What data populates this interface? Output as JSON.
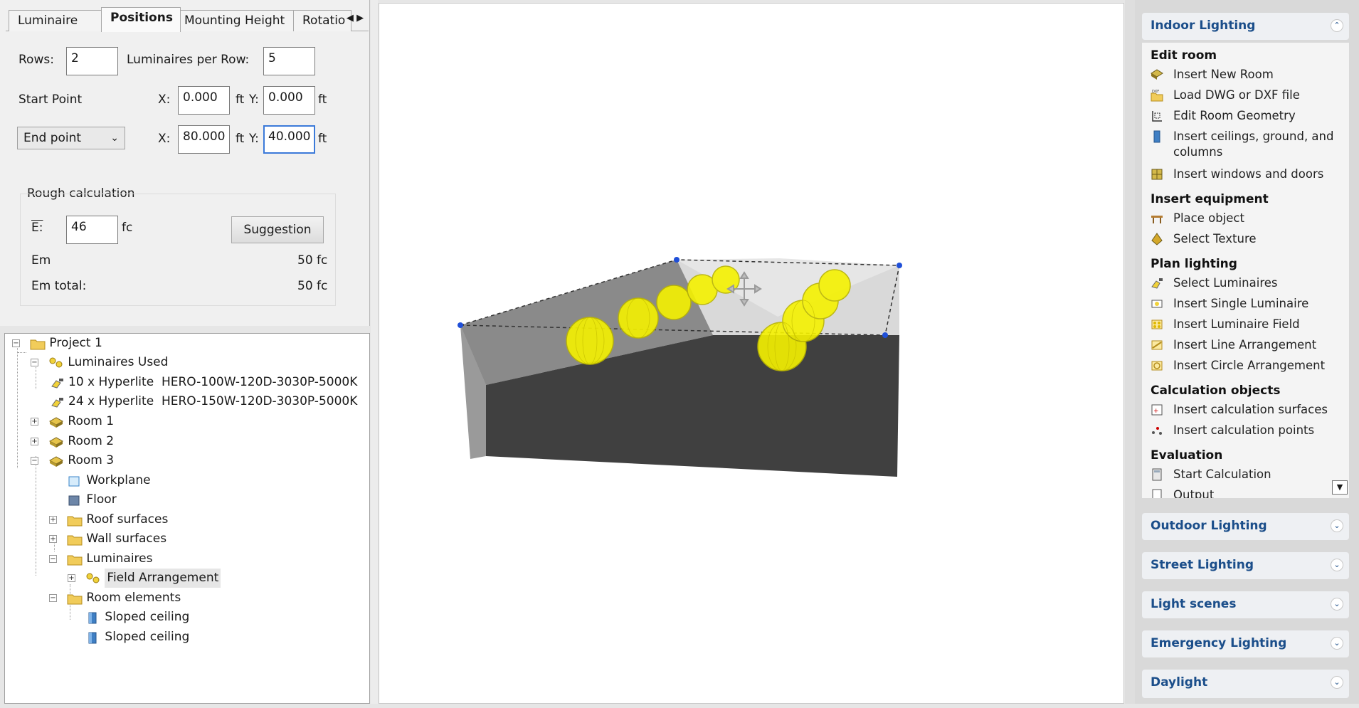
{
  "tabs": {
    "items": [
      "Luminaire",
      "Positions",
      "Mounting Height",
      "Rotatio"
    ],
    "active": "Positions"
  },
  "positions": {
    "rows_label": "Rows:",
    "rows_value": "2",
    "per_row_label": "Luminaires per Row:",
    "per_row_value": "5",
    "start_point_label": "Start Point",
    "x_label": "X:",
    "y_label": "Y:",
    "unit": "ft",
    "start_x": "0.000",
    "start_y": "0.000",
    "end_mode": "End point",
    "end_x": "80.000",
    "end_y": "40.000"
  },
  "rough_calc": {
    "group_label": "Rough calculation",
    "e_label": "E:",
    "e_value": "46",
    "e_unit": "fc",
    "suggestion_button": "Suggestion",
    "em_label": "Em",
    "em_value": "50 fc",
    "em_total_label": "Em total:",
    "em_total_value": "50 fc"
  },
  "tree": {
    "project": "Project 1",
    "luminaires_used": "Luminaires Used",
    "lum1_count": "10 x Hyperlite",
    "lum1_model": "HERO-100W-120D-3030P-5000K",
    "lum2_count": "24 x Hyperlite",
    "lum2_model": "HERO-150W-120D-3030P-5000K",
    "room1": "Room 1",
    "room2": "Room 2",
    "room3": "Room 3",
    "workplane": "Workplane",
    "floor": "Floor",
    "roof_surfaces": "Roof surfaces",
    "wall_surfaces": "Wall surfaces",
    "luminaires": "Luminaires",
    "field_arrangement": "Field Arrangement",
    "room_elements": "Room elements",
    "sloped1": "Sloped ceiling",
    "sloped2": "Sloped ceiling"
  },
  "guide": {
    "indoor": {
      "title": "Indoor Lighting",
      "edit_room": "Edit room",
      "insert_new_room": "Insert New Room",
      "load_dwg": "Load DWG or DXF file",
      "edit_geometry": "Edit Room Geometry",
      "insert_ceilings": "Insert ceilings, ground, and columns",
      "insert_windows": "Insert windows and doors",
      "insert_equipment": "Insert equipment",
      "place_object": "Place object",
      "select_texture": "Select Texture",
      "plan_lighting": "Plan lighting",
      "select_luminaires": "Select Luminaires",
      "insert_single": "Insert Single Luminaire",
      "insert_field": "Insert Luminaire Field",
      "insert_line": "Insert Line Arrangement",
      "insert_circle": "Insert Circle Arrangement",
      "calc_objects": "Calculation objects",
      "insert_calc_surfaces": "Insert calculation surfaces",
      "insert_calc_points": "Insert calculation points",
      "evaluation": "Evaluation",
      "start_calc": "Start Calculation",
      "output": "Output"
    },
    "sections": [
      "Outdoor Lighting",
      "Street Lighting",
      "Light scenes",
      "Emergency Lighting",
      "Daylight"
    ]
  },
  "colors": {
    "accent_blue": "#1b4e8a",
    "luminaire_yellow": "#f5f200",
    "focus_blue": "#3b7ad9"
  }
}
